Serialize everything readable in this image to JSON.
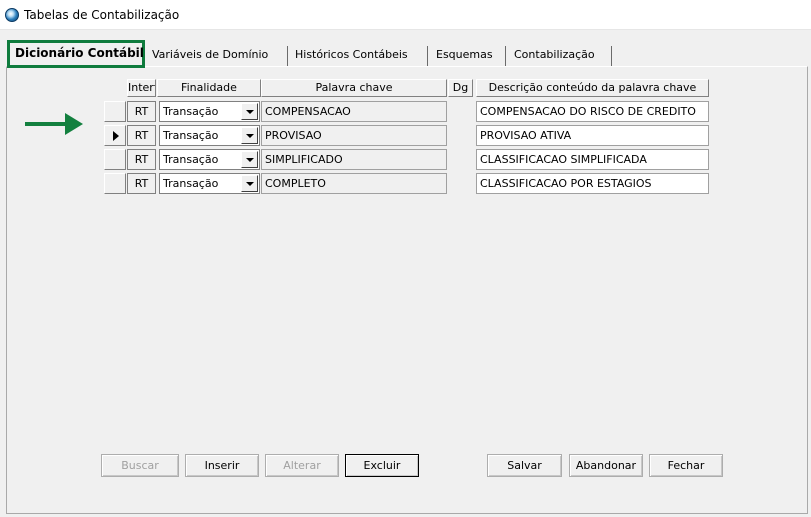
{
  "window": {
    "title": "Tabelas de Contabilização"
  },
  "tabs": [
    {
      "label": "Dicionário Contábil",
      "active": true
    },
    {
      "label": "Variáveis de Domínio",
      "active": false
    },
    {
      "label": "Históricos Contábeis",
      "active": false
    },
    {
      "label": "Esquemas",
      "active": false
    },
    {
      "label": "Contabilização",
      "active": false
    }
  ],
  "grid": {
    "columns": [
      "Interf",
      "Finalidade",
      "Palavra chave",
      "Dg",
      "Descrição conteúdo da palavra chave"
    ],
    "current_row": 1,
    "rows": [
      {
        "interf": "RT",
        "finalidade": "Transação",
        "palavra": "COMPENSACAO",
        "dg": "",
        "descricao": "COMPENSACAO DO RISCO DE CREDITO"
      },
      {
        "interf": "RT",
        "finalidade": "Transação",
        "palavra": "PROVISAO",
        "dg": "",
        "descricao": "PROVISAO ATIVA"
      },
      {
        "interf": "RT",
        "finalidade": "Transação",
        "palavra": "SIMPLIFICADO",
        "dg": "",
        "descricao": "CLASSIFICACAO SIMPLIFICADA"
      },
      {
        "interf": "RT",
        "finalidade": "Transação",
        "palavra": "COMPLETO",
        "dg": "",
        "descricao": "CLASSIFICACAO POR ESTAGIOS"
      }
    ]
  },
  "buttons": {
    "buscar": "Buscar",
    "inserir": "Inserir",
    "alterar": "Alterar",
    "excluir": "Excluir",
    "salvar": "Salvar",
    "abandonar": "Abandonar",
    "fechar": "Fechar"
  },
  "annotation": {
    "arrow_color": "#13803f",
    "highlight_color": "#0f7b3d"
  }
}
